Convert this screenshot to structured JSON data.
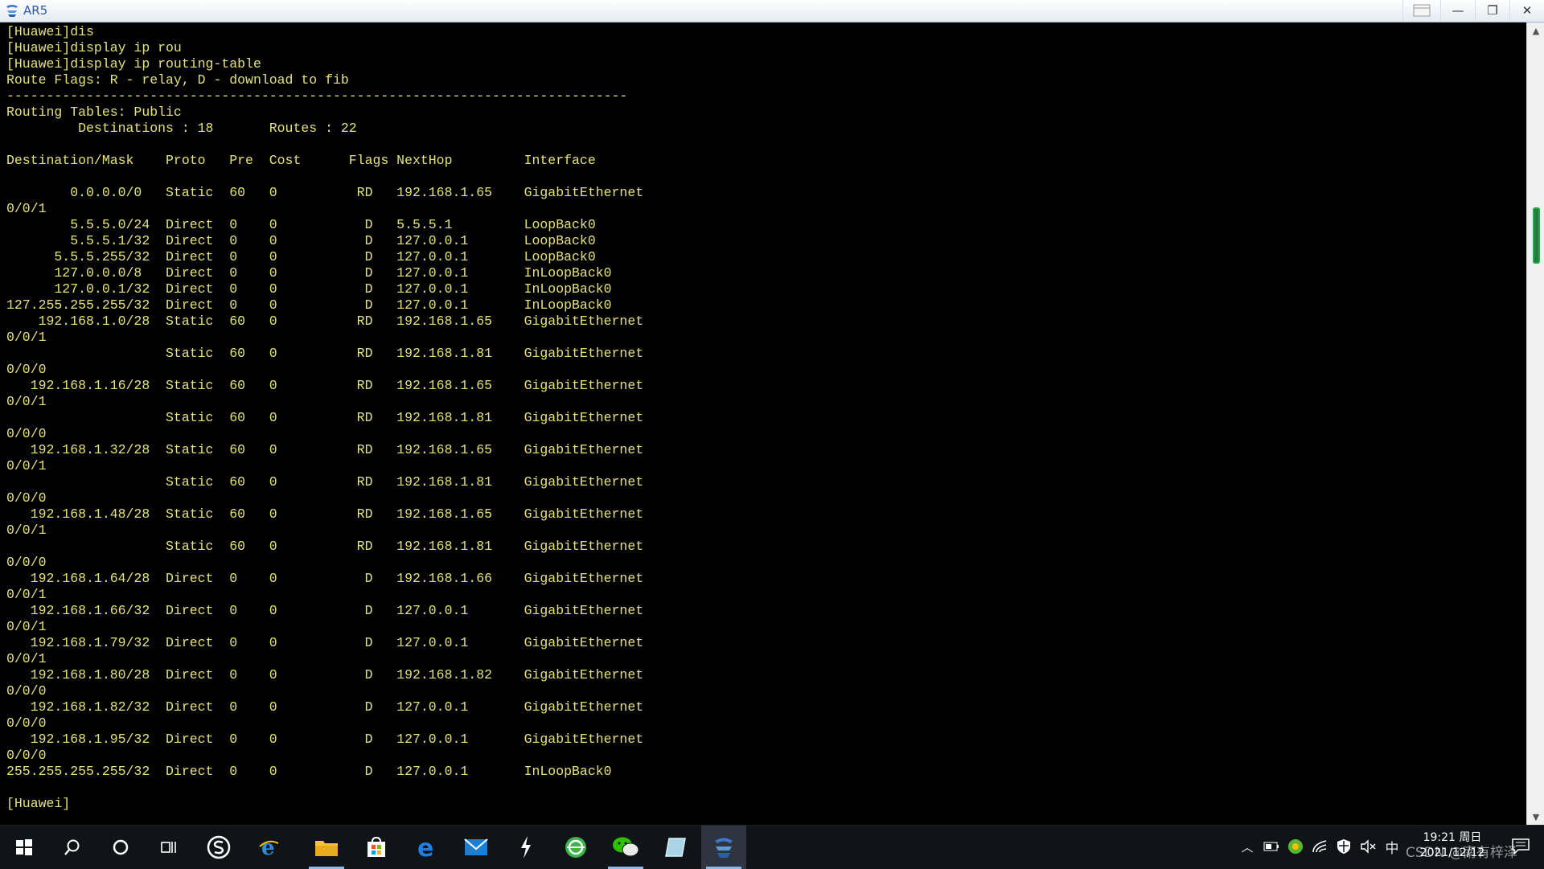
{
  "window": {
    "title": "AR5",
    "controls": [
      "—",
      "❐",
      "✕"
    ]
  },
  "terminal": {
    "lines": [
      "[Huawei]dis",
      "[Huawei]display ip rou",
      "[Huawei]display ip routing-table",
      "Route Flags: R - relay, D - download to fib",
      "------------------------------------------------------------------------------",
      "Routing Tables: Public",
      "         Destinations : 18       Routes : 22",
      "",
      "Destination/Mask    Proto   Pre  Cost      Flags NextHop         Interface",
      "",
      "        0.0.0.0/0   Static  60   0          RD   192.168.1.65    GigabitEthernet",
      "0/0/1",
      "        5.5.5.0/24  Direct  0    0           D   5.5.5.1         LoopBack0",
      "        5.5.5.1/32  Direct  0    0           D   127.0.0.1       LoopBack0",
      "      5.5.5.255/32  Direct  0    0           D   127.0.0.1       LoopBack0",
      "      127.0.0.0/8   Direct  0    0           D   127.0.0.1       InLoopBack0",
      "      127.0.0.1/32  Direct  0    0           D   127.0.0.1       InLoopBack0",
      "127.255.255.255/32  Direct  0    0           D   127.0.0.1       InLoopBack0",
      "    192.168.1.0/28  Static  60   0          RD   192.168.1.65    GigabitEthernet",
      "0/0/1",
      "                    Static  60   0          RD   192.168.1.81    GigabitEthernet",
      "0/0/0",
      "   192.168.1.16/28  Static  60   0          RD   192.168.1.65    GigabitEthernet",
      "0/0/1",
      "                    Static  60   0          RD   192.168.1.81    GigabitEthernet",
      "0/0/0",
      "   192.168.1.32/28  Static  60   0          RD   192.168.1.65    GigabitEthernet",
      "0/0/1",
      "                    Static  60   0          RD   192.168.1.81    GigabitEthernet",
      "0/0/0",
      "   192.168.1.48/28  Static  60   0          RD   192.168.1.65    GigabitEthernet",
      "0/0/1",
      "                    Static  60   0          RD   192.168.1.81    GigabitEthernet",
      "0/0/0",
      "   192.168.1.64/28  Direct  0    0           D   192.168.1.66    GigabitEthernet",
      "0/0/1",
      "   192.168.1.66/32  Direct  0    0           D   127.0.0.1       GigabitEthernet",
      "0/0/1",
      "   192.168.1.79/32  Direct  0    0           D   127.0.0.1       GigabitEthernet",
      "0/0/1",
      "   192.168.1.80/28  Direct  0    0           D   192.168.1.82    GigabitEthernet",
      "0/0/0",
      "   192.168.1.82/32  Direct  0    0           D   127.0.0.1       GigabitEthernet",
      "0/0/0",
      "   192.168.1.95/32  Direct  0    0           D   127.0.0.1       GigabitEthernet",
      "0/0/0",
      "255.255.255.255/32  Direct  0    0           D   127.0.0.1       InLoopBack0",
      "",
      "[Huawei]"
    ],
    "text_color": "#e6e27a",
    "background": "#000000"
  },
  "taskbar": {
    "apps": [
      {
        "name": "start-icon"
      },
      {
        "name": "search-icon"
      },
      {
        "name": "cortana-icon"
      },
      {
        "name": "task-view-icon"
      },
      {
        "name": "pinned-app-s-icon"
      },
      {
        "name": "ie-icon"
      },
      {
        "name": "file-explorer-icon"
      },
      {
        "name": "store-icon"
      },
      {
        "name": "edge-icon"
      },
      {
        "name": "mail-icon"
      },
      {
        "name": "pinned-app-bolt-icon"
      },
      {
        "name": "browser-360-icon"
      },
      {
        "name": "wechat-icon"
      },
      {
        "name": "pinned-app-glass-icon"
      },
      {
        "name": "ensp-icon"
      }
    ],
    "tray": {
      "ime": "中",
      "time": "19:21 周日",
      "date": "2021/12/12"
    },
    "watermark": "CSDN @南有梓泽"
  }
}
